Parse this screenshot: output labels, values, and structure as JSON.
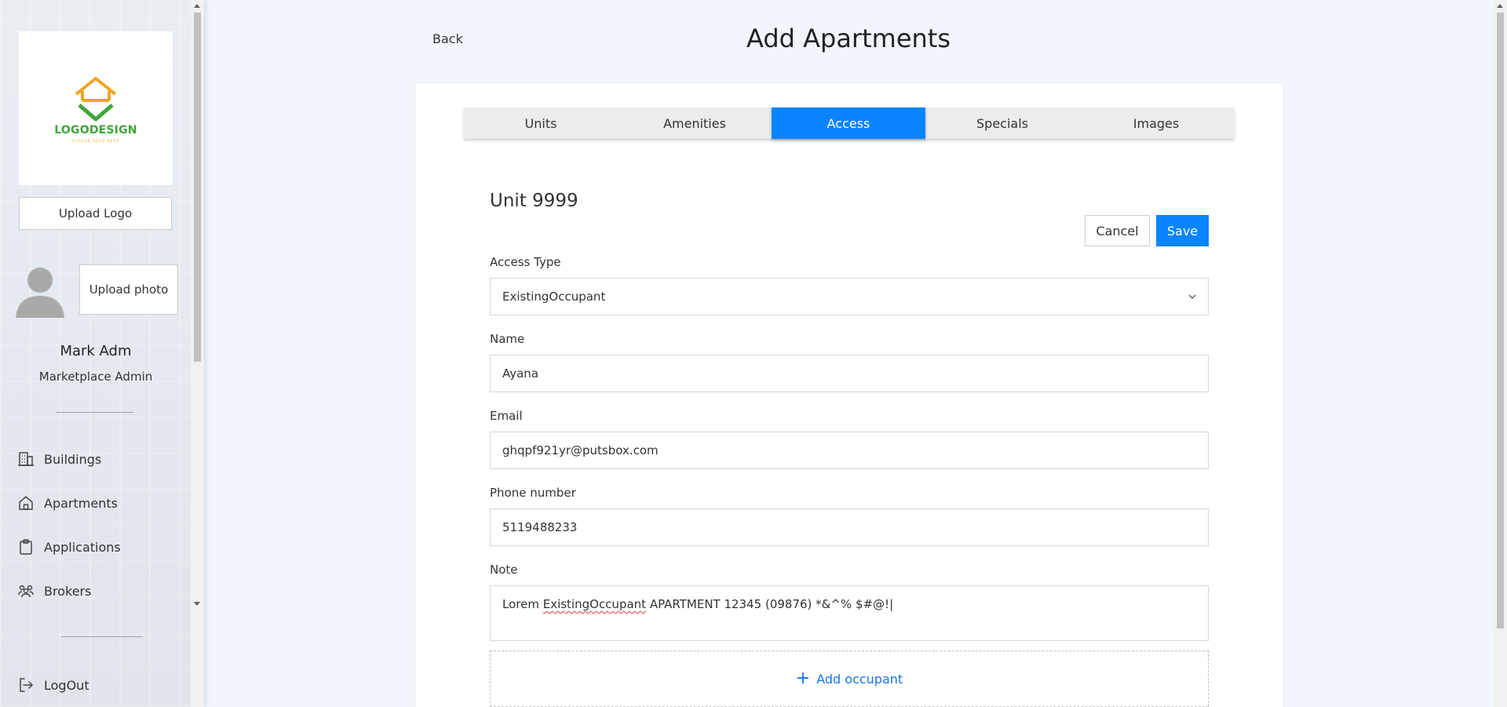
{
  "sidebar": {
    "logo_brand": "LOGODESIGN",
    "logo_tagline": "SLOGAN GOES HERE",
    "upload_logo_label": "Upload Logo",
    "upload_photo_label": "Upload photo",
    "user_name": "Mark Adm",
    "user_role": "Marketplace Admin",
    "nav": [
      {
        "label": "Buildings",
        "icon": "buildings-icon"
      },
      {
        "label": "Apartments",
        "icon": "home-icon"
      },
      {
        "label": "Applications",
        "icon": "clipboard-icon"
      },
      {
        "label": "Brokers",
        "icon": "people-icon"
      }
    ],
    "logout_label": "LogOut"
  },
  "header": {
    "back_label": "Back",
    "title": "Add Apartments"
  },
  "tabs": [
    {
      "label": "Units",
      "active": false
    },
    {
      "label": "Amenities",
      "active": false
    },
    {
      "label": "Access",
      "active": true
    },
    {
      "label": "Specials",
      "active": false
    },
    {
      "label": "Images",
      "active": false
    }
  ],
  "form": {
    "unit_title": "Unit 9999",
    "cancel_label": "Cancel",
    "save_label": "Save",
    "access_type": {
      "label": "Access Type",
      "value": "ExistingOccupant"
    },
    "name": {
      "label": "Name",
      "value": "Ayana"
    },
    "email": {
      "label": "Email",
      "value": "ghqpf921yr@putsbox.com"
    },
    "phone": {
      "label": "Phone number",
      "value": "5119488233"
    },
    "note": {
      "label": "Note",
      "value_prefix": "Lorem ",
      "value_misspelled": "ExistingOccupant",
      "value_suffix": " APARTMENT 12345 (09876) *&^% $#@!|"
    },
    "add_occupant_label": "Add occupant"
  },
  "colors": {
    "accent": "#0a84ff",
    "link": "#1a73e8",
    "logo_green": "#3ea63a",
    "logo_orange": "#f4a321"
  }
}
